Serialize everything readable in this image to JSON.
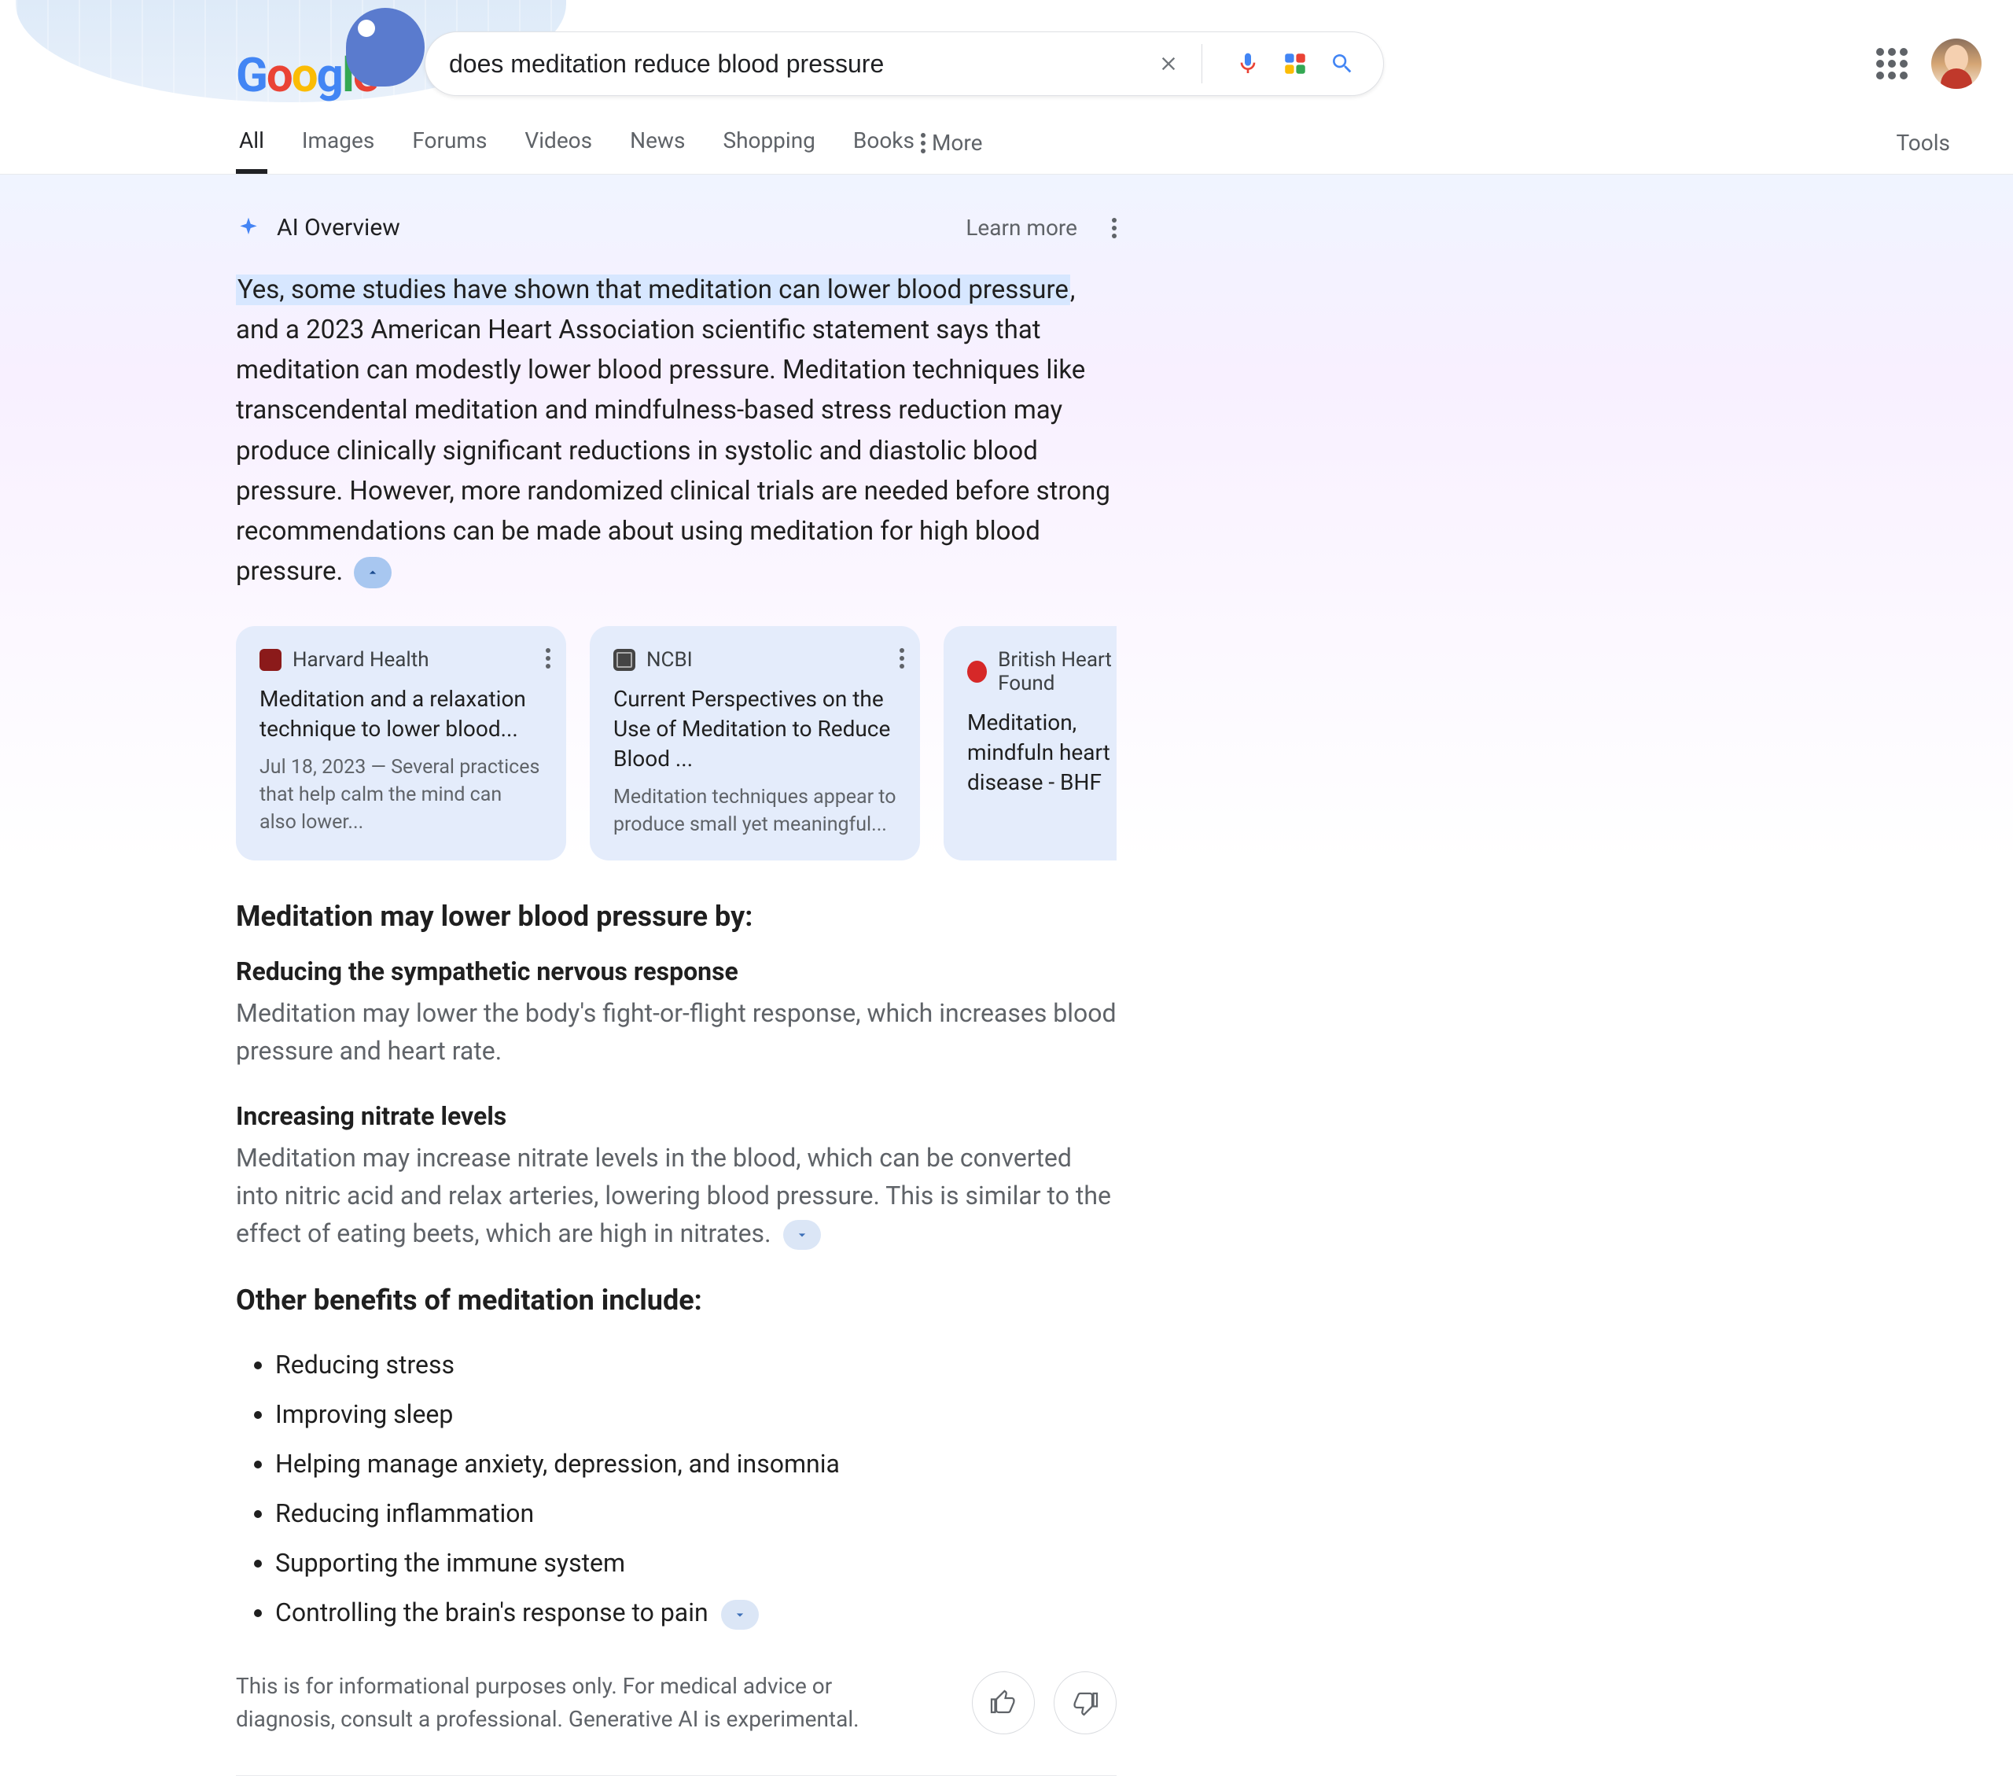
{
  "search": {
    "query": "does meditation reduce blood pressure"
  },
  "tabs": {
    "items": [
      "All",
      "Images",
      "Forums",
      "Videos",
      "News",
      "Shopping",
      "Books"
    ],
    "more": "More",
    "tools": "Tools",
    "active_index": 0
  },
  "ai": {
    "label": "AI Overview",
    "learn_more": "Learn more",
    "highlight": "Yes, some studies have shown that meditation can lower blood pressure",
    "body_rest": ", and a 2023 American Heart Association scientific statement says that meditation can modestly lower blood pressure. Meditation techniques like transcendental meditation and mindfulness-based stress reduction may produce clinically significant reductions in systolic and diastolic blood pressure. However, more randomized clinical trials are needed before strong recommendations can be made about using meditation for high blood pressure."
  },
  "sources": [
    {
      "name": "Harvard Health",
      "title": "Meditation and a relaxation technique to lower blood...",
      "snippet": "Jul 18, 2023 — Several practices that help calm the mind can also lower...",
      "favicon": "fv-harvard"
    },
    {
      "name": "NCBI",
      "title": "Current Perspectives on the Use of Meditation to Reduce Blood ...",
      "snippet": "Meditation techniques appear to produce small yet meaningful...",
      "favicon": "fv-ncbi"
    },
    {
      "name": "British Heart Found",
      "title": "Meditation, mindfuln heart disease - BHF",
      "snippet": "",
      "favicon": "fv-bhf"
    }
  ],
  "sections": {
    "heading1": "Meditation may lower blood pressure by:",
    "item1_title": "Reducing the sympathetic nervous response",
    "item1_body": "Meditation may lower the body's fight-or-flight response, which increases blood pressure and heart rate.",
    "item2_title": "Increasing nitrate levels",
    "item2_body": "Meditation may increase nitrate levels in the blood, which can be converted into nitric acid and relax arteries, lowering blood pressure. This is similar to the effect of eating beets, which are high in nitrates.",
    "heading2": "Other benefits of meditation include:",
    "benefits": [
      "Reducing stress",
      "Improving sleep",
      "Helping manage anxiety, depression, and insomnia",
      "Reducing inflammation",
      "Supporting the immune system",
      "Controlling the brain's response to pain"
    ]
  },
  "disclaimer": "This is for informational purposes only. For medical advice or diagnosis, consult a professional. Generative AI is experimental."
}
